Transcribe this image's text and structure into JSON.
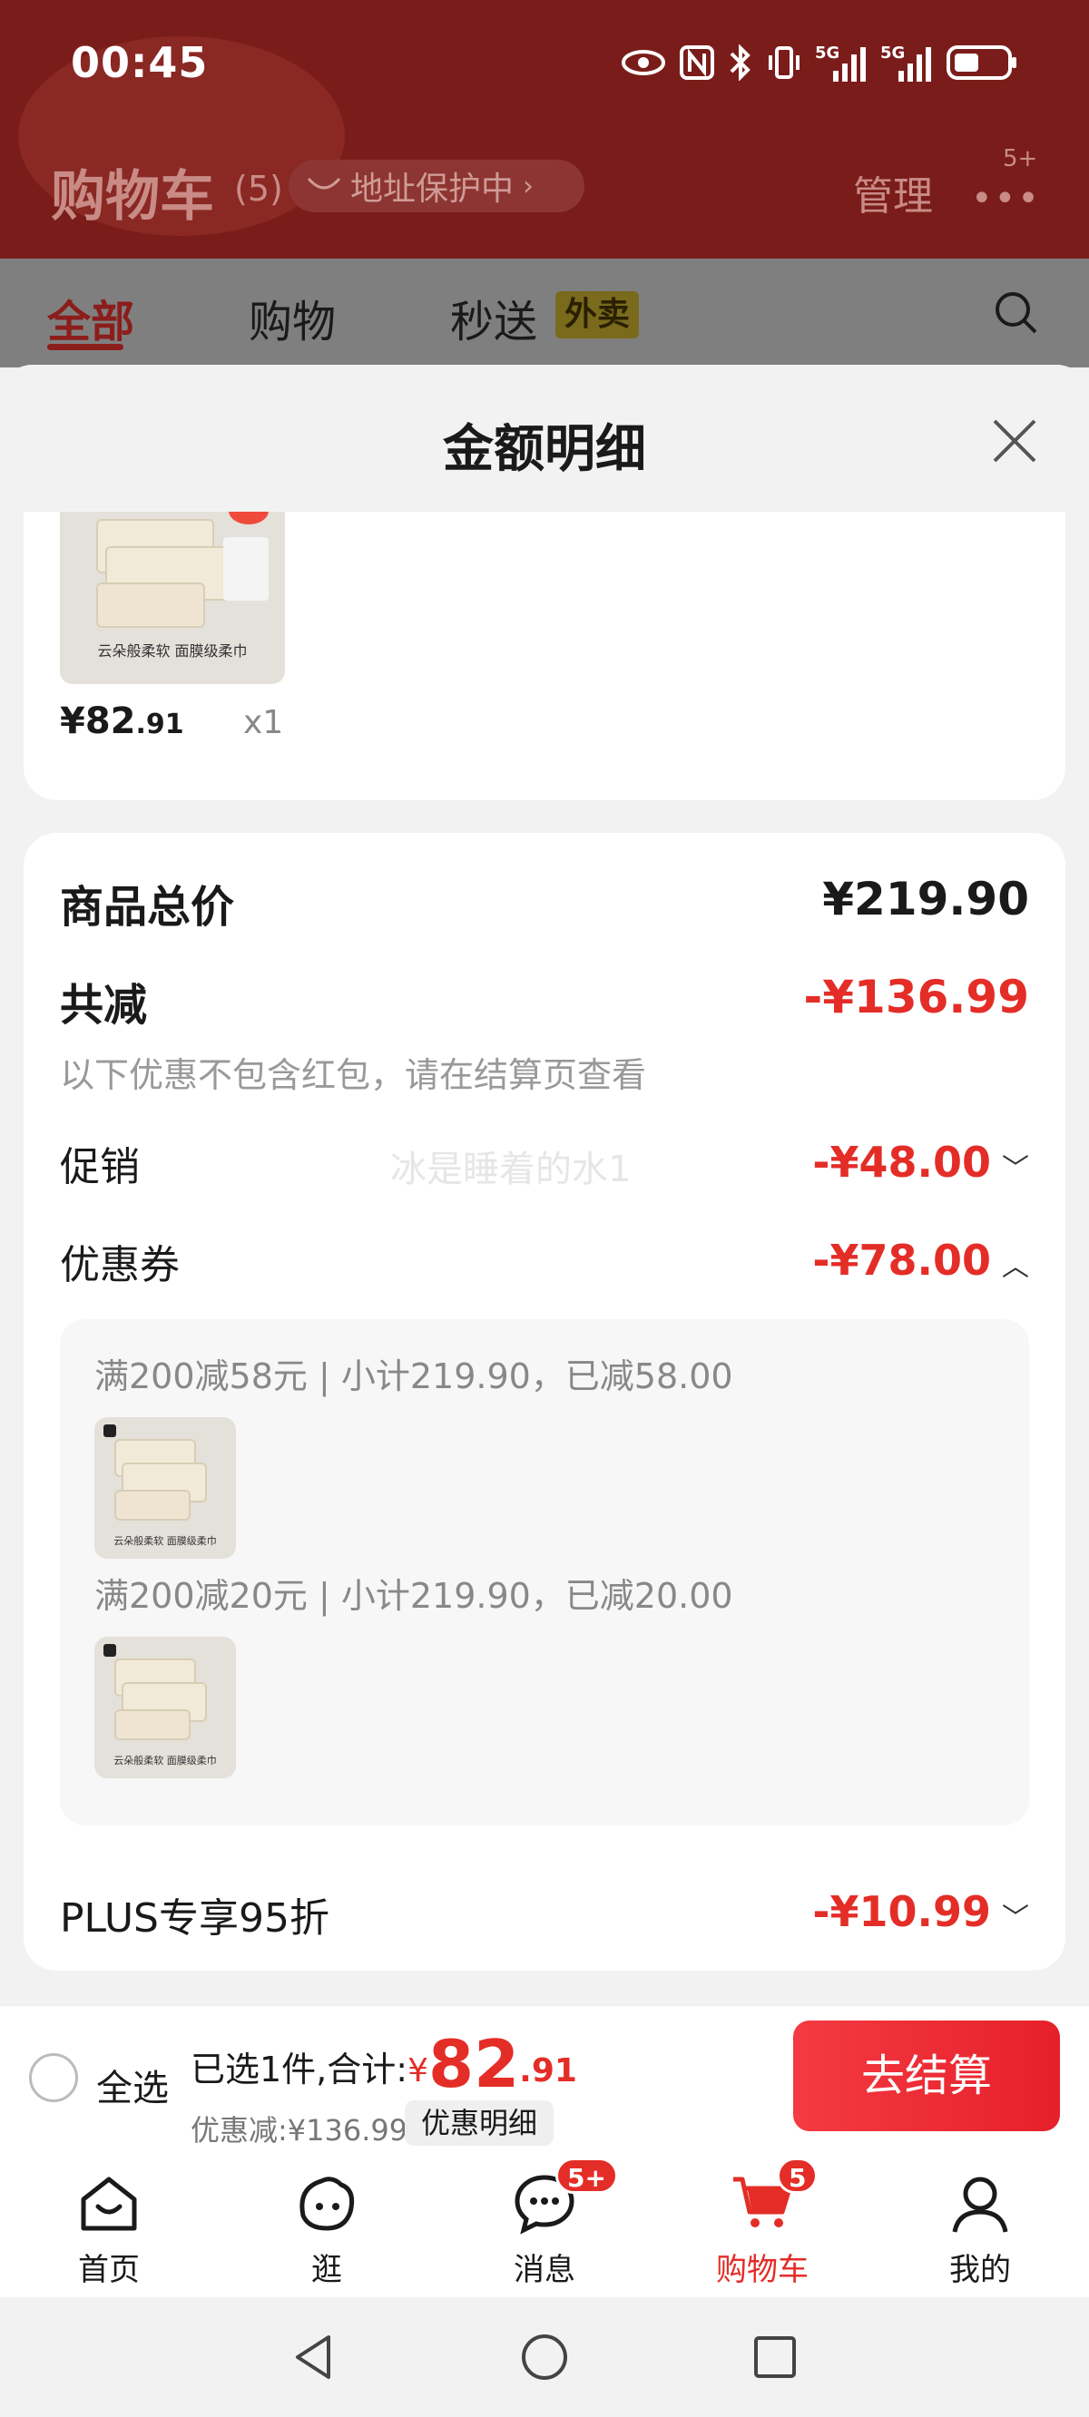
{
  "status_bar": {
    "time": "00:45",
    "icons": [
      "eye-icon",
      "nfc-icon",
      "bluetooth-icon",
      "vibrate-icon",
      "signal-5g-icon",
      "signal-5g-icon",
      "battery-icon"
    ],
    "signal_label_1": "5G",
    "signal_label_2": "5G"
  },
  "header": {
    "title": "购物车",
    "count": "(5)",
    "address_label": "地址保护中",
    "manage_label": "管理",
    "more_badge": "5+"
  },
  "tabs": {
    "all": "全部",
    "shopping": "购物",
    "instant": "秒送",
    "instant_tag": "外卖"
  },
  "sheet": {
    "title": "金额明细",
    "item": {
      "thumb_caption": "云朵般柔软 面膜级柔巾",
      "price_yen": "¥82",
      "price_dec": ".91",
      "quantity": "x1"
    },
    "total_label": "商品总价",
    "total_value": "¥219.90",
    "reduce_label": "共减",
    "reduce_value": "-¥136.99",
    "reduce_note": "以下优惠不包含红包，请在结算页查看",
    "promo_label": "促销",
    "promo_value": "-¥48.00",
    "watermark": "冰是睡着的水1",
    "coupon_label": "优惠券",
    "coupon_value": "-¥78.00",
    "coupons": [
      {
        "text": "满200减58元 | 小计219.90，已减58.00",
        "thumb_caption": "云朵般柔软 面膜级柔巾"
      },
      {
        "text": "满200减20元 | 小计219.90，已减20.00",
        "thumb_caption": "云朵般柔软 面膜级柔巾"
      }
    ],
    "plus_label": "PLUS专享95折",
    "plus_value": "-¥10.99"
  },
  "bottom_bar": {
    "select_all": "全选",
    "summary_prefix": "已选1件,合计:",
    "yen": "¥",
    "amount_int": "82",
    "amount_dec": ".91",
    "discount": "优惠减:¥136.99",
    "detail_button": "优惠明细",
    "checkout_button": "去结算"
  },
  "tab_bar": {
    "home": "首页",
    "browse": "逛",
    "messages": "消息",
    "messages_badge": "5+",
    "cart": "购物车",
    "cart_badge": "5",
    "mine": "我的"
  },
  "colors": {
    "accent_red": "#e42d27",
    "header_dark_red": "#7a1d1a",
    "overlay_gray": "#7f7f7f"
  }
}
